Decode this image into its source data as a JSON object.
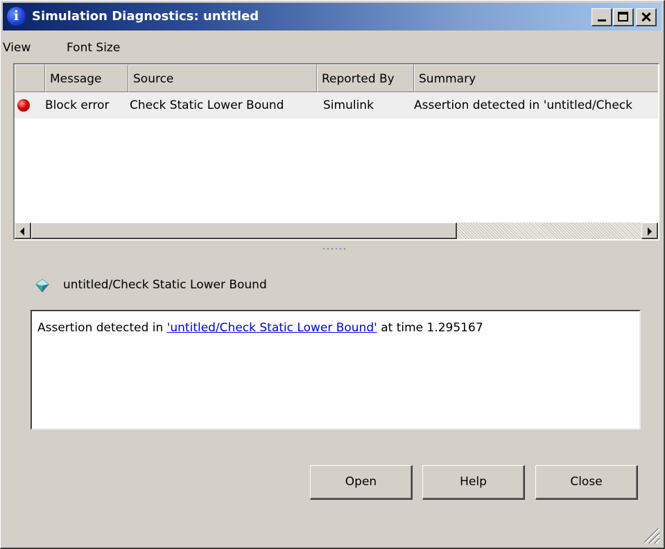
{
  "window": {
    "title": "Simulation Diagnostics: untitled",
    "title_icon": "i"
  },
  "menu": {
    "items": [
      "View",
      "Font Size"
    ]
  },
  "table": {
    "columns": [
      "",
      "Message",
      "Source",
      "Reported By",
      "Summary"
    ],
    "rows": [
      {
        "icon": "error-icon",
        "message": "Block error",
        "source": "Check Static Lower Bound",
        "reported_by": "Simulink",
        "summary": "Assertion detected in 'untitled/Check"
      }
    ]
  },
  "detail": {
    "block_path": "untitled/Check Static  Lower Bound",
    "message_prefix": "Assertion detected in ",
    "message_link": "'untitled/Check Static Lower Bound'",
    "message_suffix": " at time 1.295167"
  },
  "buttons": {
    "open": "Open",
    "help": "Help",
    "close": "Close"
  },
  "colors": {
    "title_gradient_start": "#0a246a",
    "title_gradient_end": "#a6caf0",
    "dialog_background": "#d4d0c8",
    "link": "#0000ee",
    "error": "#e00000"
  }
}
